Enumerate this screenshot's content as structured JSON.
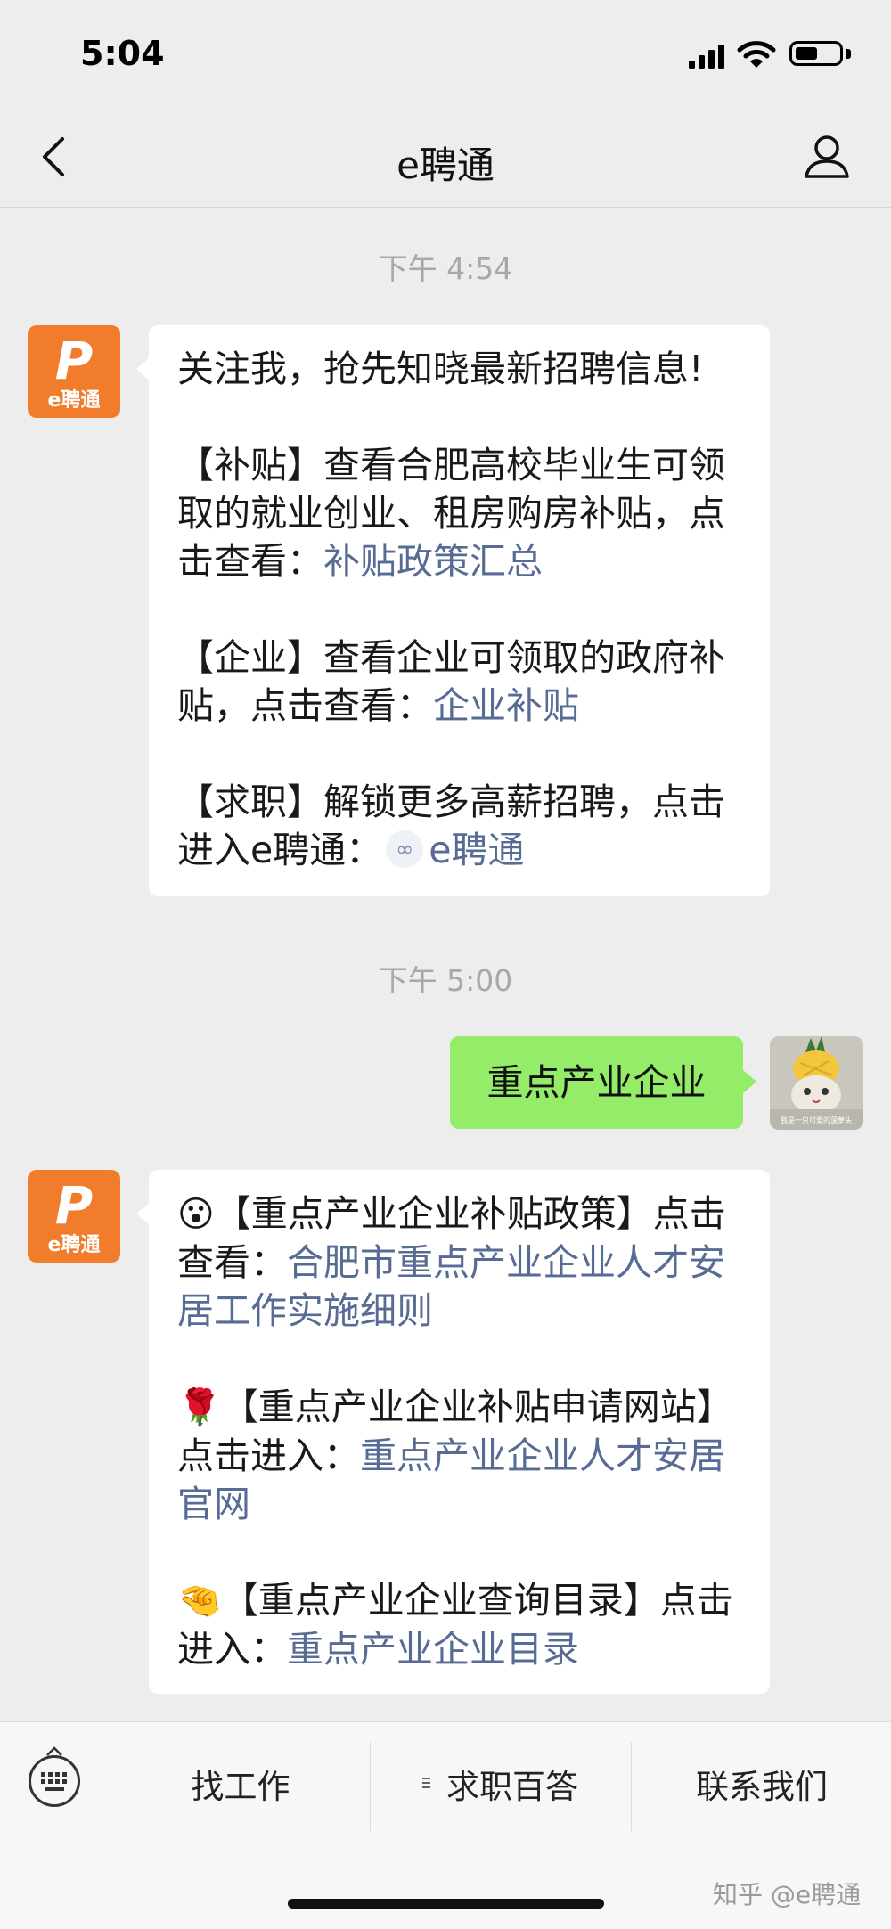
{
  "status_bar": {
    "time": "5:04"
  },
  "nav": {
    "title": "e聘通"
  },
  "chat": {
    "timestamp_1": "下午 4:54",
    "bot_avatar_label": "e聘通",
    "msg1": {
      "intro": "关注我，抢先知晓最新招聘信息!",
      "subsidy_text": "【补贴】查看合肥高校毕业生可领取的就业创业、租房购房补贴，点击查看：",
      "subsidy_link": "补贴政策汇总",
      "enterprise_text": "【企业】查看企业可领取的政府补贴，点击查看：",
      "enterprise_link": "企业补贴",
      "job_text": "【求职】解锁更多高薪招聘，点击进入e聘通：",
      "job_link": "e聘通"
    },
    "timestamp_2": "下午 5:00",
    "user_message": "重点产业企业",
    "user_avatar_caption": "我是一只可爱的菠萝头",
    "msg2": {
      "item1_emoji": "😮",
      "item1_text": "【重点产业企业补贴政策】点击查看：",
      "item1_link": "合肥市重点产业企业人才安居工作实施细则",
      "item2_emoji": "🌹",
      "item2_text": "【重点产业企业补贴申请网站】点击进入：",
      "item2_link": "重点产业企业人才安居官网",
      "item3_emoji": "🤏",
      "item3_text": "【重点产业企业查询目录】点击进入：",
      "item3_link": "重点产业企业目录"
    }
  },
  "bottom_menu": {
    "item1": "找工作",
    "item2": "求职百答",
    "item3": "联系我们"
  },
  "watermark": "知乎 @e聘通",
  "colors": {
    "link": "#576b95",
    "user_bubble": "#95ec69",
    "brand_orange": "#f07c2c",
    "background": "#ededed"
  },
  "icons": [
    "signal-icon",
    "wifi-icon",
    "battery-icon",
    "back-arrow-icon",
    "profile-icon",
    "mini-program-icon",
    "keyboard-icon",
    "submenu-icon"
  ]
}
